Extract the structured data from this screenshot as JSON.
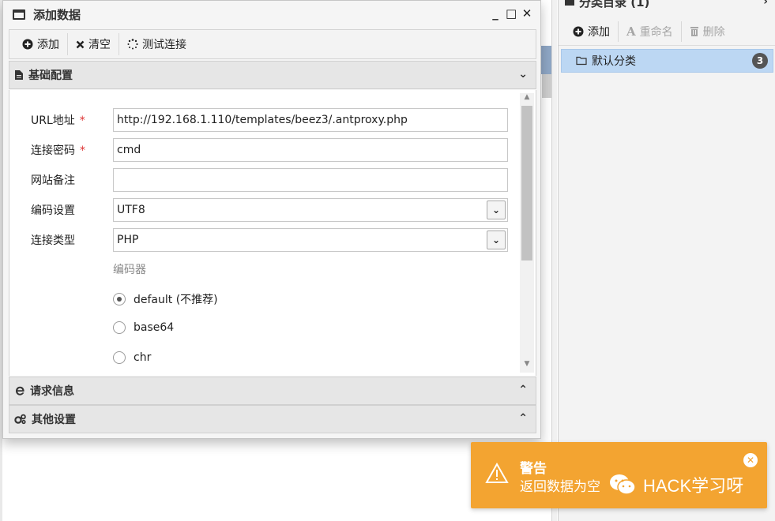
{
  "dialog": {
    "title": "添加数据",
    "controls": {
      "minimize": "_",
      "maximize": "□",
      "close": "✕"
    },
    "toolbar": {
      "add": "添加",
      "clear": "清空",
      "test": "测试连接"
    },
    "sections": {
      "basic": "基础配置",
      "request": "请求信息",
      "other": "其他设置"
    },
    "form": {
      "url_label": "URL地址",
      "url_value": "http://192.168.1.110/templates/beez3/.antproxy.php",
      "password_label": "连接密码",
      "password_value": "cmd",
      "note_label": "网站备注",
      "note_value": "",
      "encoding_label": "编码设置",
      "encoding_value": "UTF8",
      "type_label": "连接类型",
      "type_value": "PHP",
      "required_mark": "*",
      "encoder_title": "编码器",
      "encoders": [
        {
          "label": "default (不推荐)",
          "checked": true
        },
        {
          "label": "base64",
          "checked": false
        },
        {
          "label": "chr",
          "checked": false
        }
      ]
    }
  },
  "category_panel": {
    "title": "分类目录 (1)",
    "toolbar": {
      "add": "添加",
      "rename": "重命名",
      "delete": "删除"
    },
    "items": [
      {
        "label": "默认分类",
        "count": "3"
      }
    ]
  },
  "toast": {
    "title": "警告",
    "message": "返回数据为空",
    "color": "#f3a431"
  },
  "watermark": {
    "text": "HACK学习呀"
  }
}
